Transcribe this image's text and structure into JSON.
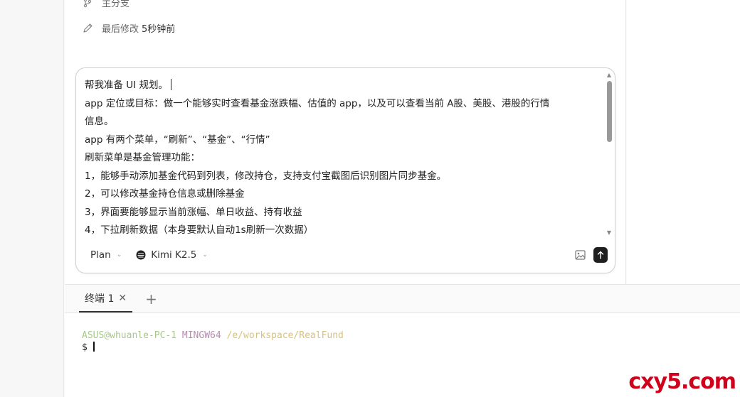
{
  "meta": {
    "branch_label": "主分支",
    "last_modified_label": "最后修改",
    "last_modified_value": "5秒钟前"
  },
  "composer": {
    "lines": [
      "帮我准备 UI 规划。",
      "app 定位或目标：做一个能够实时查看基金涨跌幅、估值的 app，以及可以查看当前 A股、美股、港股的行情",
      "信息。",
      "app 有两个菜单，“刷新”、“基金”、“行情”",
      "刷新菜单是基金管理功能：",
      "1，能够手动添加基金代码到列表，修改持仓，支持支付宝截图后识别图片同步基金。",
      "2，可以修改基金持仓信息或删除基金",
      "3，界面要能够显示当前涨幅、单日收益、持有收益",
      "4，下拉刷新数据（本身要默认自动1s刷新一次数据）"
    ],
    "mode_label": "Plan",
    "model_label": "Kimi K2.5"
  },
  "terminal": {
    "tab_label": "终端 1",
    "user_host": "ASUS@whuanle-PC-1",
    "env": "MINGW64",
    "path": "/e/workspace/RealFund",
    "prompt": "$"
  },
  "watermark": "cxy5.com",
  "icons": {
    "branch": "git-branch-icon",
    "edit": "pencil-icon",
    "image": "image-upload-icon",
    "send": "send-arrow-icon",
    "model": "kimi-logo-icon"
  },
  "colors": {
    "terminal_user": "#a7c88a",
    "terminal_env": "#b48ead",
    "terminal_path": "#d8c27a",
    "watermark": "#d0021b"
  }
}
